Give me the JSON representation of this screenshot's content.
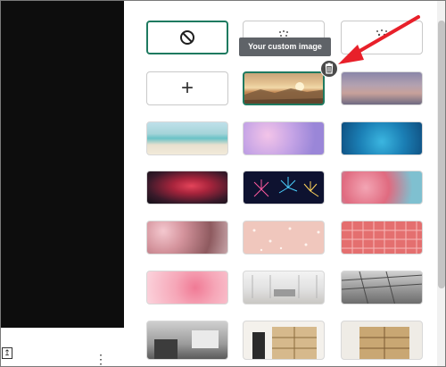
{
  "tooltip": {
    "text": "Your custom image"
  },
  "left_toolbar": {
    "upload_glyph": "↥",
    "more_glyph": "⋮"
  },
  "options": [
    {
      "kind": "none",
      "icon": "no-background-icon",
      "label": "⃠",
      "selected": true
    },
    {
      "kind": "blur",
      "icon": "blur-slight-icon",
      "label": ""
    },
    {
      "kind": "blur",
      "icon": "blur-strong-icon",
      "label": ""
    },
    {
      "kind": "upload",
      "icon": "plus-icon",
      "label": "+"
    }
  ],
  "images": [
    {
      "name": "custom-image-sunset"
    },
    {
      "name": "background-dusk-sky"
    },
    {
      "name": "background-beach"
    },
    {
      "name": "background-pink-clouds"
    },
    {
      "name": "background-blue-water"
    },
    {
      "name": "background-red-nebula"
    },
    {
      "name": "background-fireworks"
    },
    {
      "name": "background-pink-blossoms"
    },
    {
      "name": "background-flower-field"
    },
    {
      "name": "background-peach-dots"
    },
    {
      "name": "background-red-tiles"
    },
    {
      "name": "background-pink-confetti"
    },
    {
      "name": "background-white-office"
    },
    {
      "name": "background-grey-atrium"
    },
    {
      "name": "background-living-room"
    },
    {
      "name": "background-bookshelf-room"
    },
    {
      "name": "background-shelves-interior"
    }
  ],
  "colors": {
    "accent": "#1e7a60",
    "arrow": "#e8202a",
    "tooltip_bg": "#5f6368"
  }
}
